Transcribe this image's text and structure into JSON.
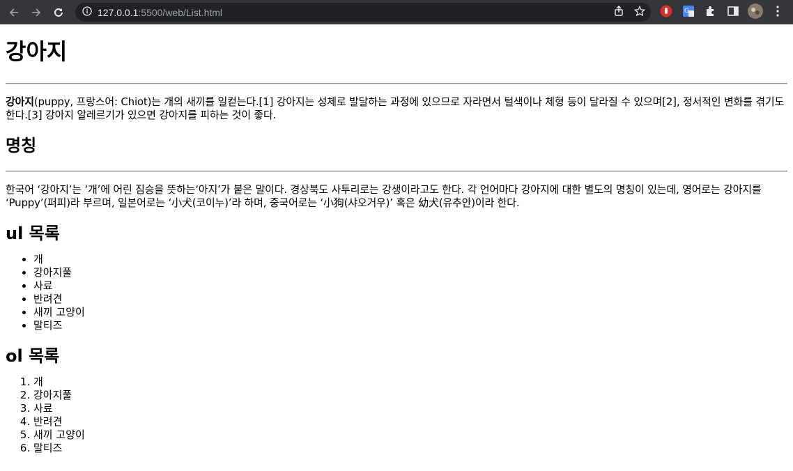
{
  "browser": {
    "url_host": "127.0.0.1",
    "url_path": ":5500/web/List.html"
  },
  "page": {
    "title": "강아지",
    "intro_bold": "강아지",
    "intro_rest": "(puppy, 프랑스어: Chiot)는 개의 새끼를 일컫는다.[1] 강아지는 성체로 발달하는 과정에 있으므로 자라면서 털색이나 체형 등이 달라질 수 있으며[2], 정서적인 변화를 겪기도 한다.[3] 강아지 알레르기가 있으면 강아지를 피하는 것이 좋다.",
    "section_name_title": "명칭",
    "section_name_text": "한국어 ‘강아지’는 ‘개’에 어린 짐승을 뜻하는‘아지’가 붙은 말이다. 경상북도 사투리로는 강생이라고도 한다. 각 언어마다 강아지에 대한 별도의 명칭이 있는데, 영어로는 강아지를 ‘Puppy’(퍼피)라 부르며, 일본어로는 ‘小犬(코이누)’라 하며, 중국어로는 ‘小狗(샤오거우)’ 혹은 幼犬(유추안)이라 한다.",
    "ul_title": "ul 목록",
    "ul_items": [
      "개",
      "강아지풀",
      "사료",
      "반려견",
      "새끼 고양이",
      "말티즈"
    ],
    "ol_title": "ol 목록",
    "ol_items": [
      "개",
      "강아지풀",
      "사료",
      "반려견",
      "새끼 고양이",
      "말티즈"
    ]
  }
}
